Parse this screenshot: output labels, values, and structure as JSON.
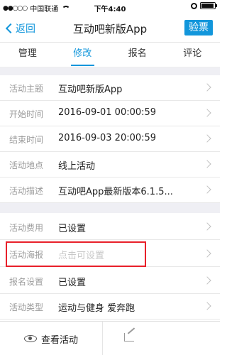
{
  "status_bar": {
    "signal_dots": "●●○○○",
    "carrier": "中国联通",
    "time": "下午4:40",
    "icons": [
      "wifi-icon",
      "alarm-icon",
      "battery-icon"
    ]
  },
  "nav": {
    "back_label": "返回",
    "title": "互动吧新版App",
    "verify_label": "验票"
  },
  "tabs": [
    {
      "label": "管理",
      "active": false
    },
    {
      "label": "修改",
      "active": true
    },
    {
      "label": "报名",
      "active": false
    },
    {
      "label": "评论",
      "active": false
    }
  ],
  "rows": [
    {
      "label": "活动主题",
      "value": "互动吧新版App",
      "placeholder": false
    },
    {
      "label": "开始时间",
      "value": "2016-09-01 00:00:59",
      "placeholder": false
    },
    {
      "label": "结束时间",
      "value": "2016-09-03 20:00:59",
      "placeholder": false
    },
    {
      "label": "活动地点",
      "value": "线上活动",
      "placeholder": false
    },
    {
      "label": "活动描述",
      "value": "互动吧App最新版本6.1.5...",
      "placeholder": false
    },
    {
      "label": "活动费用",
      "value": "已设置",
      "placeholder": false
    },
    {
      "label": "活动海报",
      "value": "点击可设置",
      "placeholder": true
    },
    {
      "label": "报名设置",
      "value": "已设置",
      "placeholder": false
    },
    {
      "label": "活动类型",
      "value": "运动与健身 爱奔跑",
      "placeholder": false
    }
  ],
  "bottom": {
    "view_label": "查看活动"
  },
  "colors": {
    "accent": "#1296db",
    "highlight": "#e8202a",
    "placeholder_text": "#c8c8c8",
    "label_text": "#9b9b9b"
  }
}
